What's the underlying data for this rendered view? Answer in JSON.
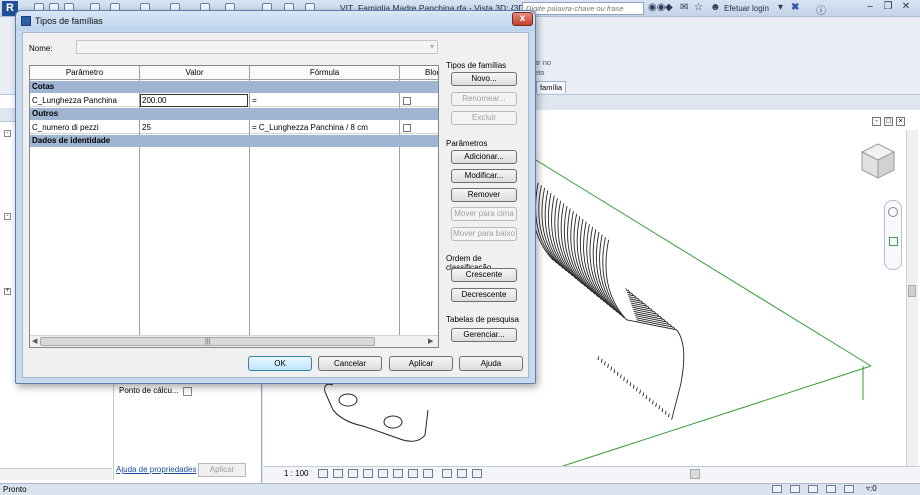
{
  "app": {
    "title": "VIT_Famiglia Madre Panchina.rfa - Vista 3D: {3D}",
    "search_placeholder": "Digite palavra-chave ou frase",
    "login_label": "Efetuar login",
    "ribbon_tab_active": "família",
    "ribbon_text_1": "ar no",
    "ribbon_text_2": "eto"
  },
  "properties_panel": {
    "row_label": "Ponto de cálcu...",
    "help_link": "Ajuda de propriedades",
    "apply_button": "Aplicar"
  },
  "view": {
    "scale": "1 : 100"
  },
  "status": {
    "text": "Pronto",
    "filter_count": ":0"
  },
  "dialog": {
    "title": "Tipos de famílias",
    "close_label": "x",
    "name_label": "Nome:",
    "name_value": "",
    "columns": [
      "Parâmetro",
      "Valor",
      "Fórmula",
      "Bloq"
    ],
    "groups": [
      {
        "label": "Cotas",
        "rows": [
          {
            "parametro": "C_Lunghezza Panchina",
            "valor": "200.00",
            "formula": "="
          }
        ]
      },
      {
        "label": "Outros",
        "rows": [
          {
            "parametro": "C_numero di pezzi",
            "valor": "25",
            "formula": "= C_Lunghezza Panchina / 8 cm"
          }
        ]
      },
      {
        "label": "Dados de identidade",
        "rows": []
      }
    ],
    "family_types": {
      "label": "Tipos de famílias",
      "buttons": {
        "novo": "Novo...",
        "renomear": "Renomear...",
        "excluir": "Excluir"
      }
    },
    "parameters": {
      "label": "Parâmetros",
      "buttons": {
        "adicionar": "Adicionar...",
        "modificar": "Modificar...",
        "remover": "Remover",
        "mover_cima": "Mover para cima",
        "mover_baixo": "Mover para baixo"
      }
    },
    "sort_order": {
      "label": "Ordem de classificação",
      "buttons": {
        "crescente": "Crescente",
        "decrescente": "Decrescente"
      }
    },
    "lookup_tables": {
      "label": "Tabelas de pesquisa",
      "buttons": {
        "gerenciar": "Gerenciar..."
      }
    },
    "footer": {
      "ok": "OK",
      "cancelar": "Cancelar",
      "aplicar": "Aplicar",
      "ajuda": "Ajuda"
    }
  },
  "colors": {
    "group_row": "#9fb5d2",
    "model_edge": "#3a9a3a",
    "dialog_frame": "#c8daef"
  }
}
